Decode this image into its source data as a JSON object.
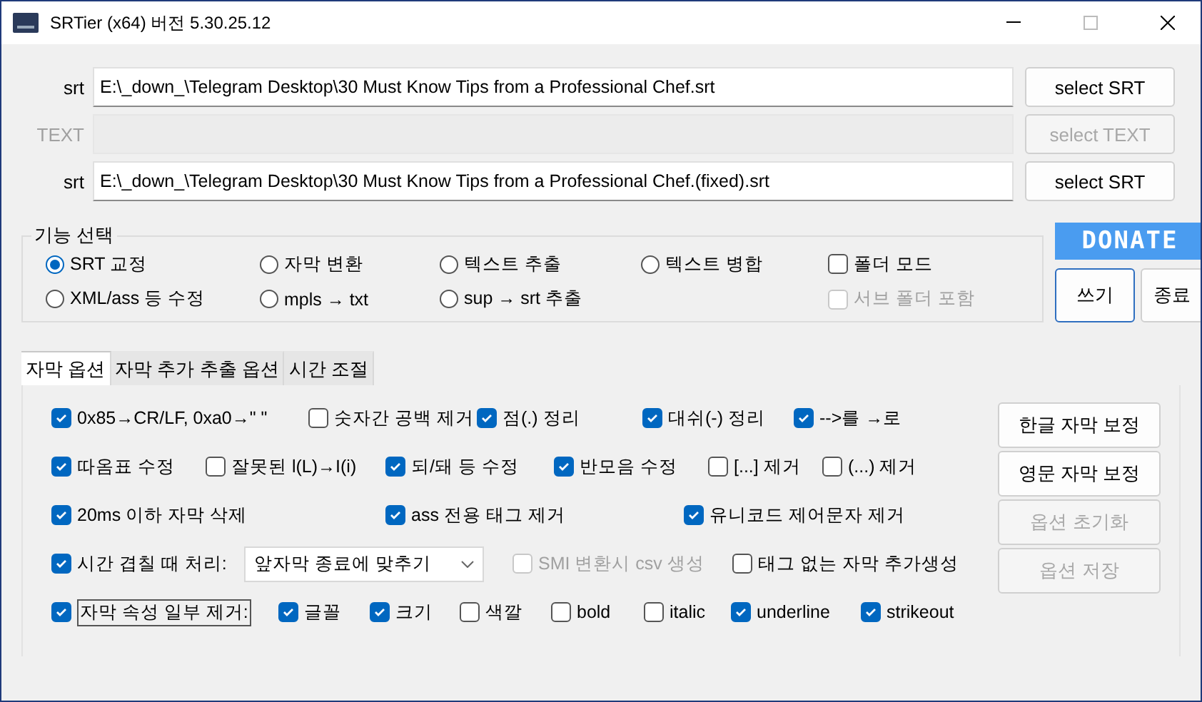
{
  "window": {
    "title": "SRTier (x64) 버전 5.30.25.12"
  },
  "files": [
    {
      "label": "srt",
      "value": "E:\\_down_\\Telegram Desktop\\30 Must Know Tips from a Professional Chef.srt",
      "button": "select SRT",
      "disabled": false
    },
    {
      "label": "TEXT",
      "button": "select TEXT",
      "disabled": true
    },
    {
      "label": "srt",
      "value": "E:\\_down_\\Telegram Desktop\\30 Must Know Tips from a Professional Chef.(fixed).srt",
      "button": "select SRT",
      "disabled": false
    }
  ],
  "function_group": {
    "title": "기능 선택",
    "items": [
      {
        "kind": "radio",
        "label": "SRT 교정",
        "selected": true,
        "disabled": false
      },
      {
        "kind": "radio",
        "label": "자막 변환",
        "selected": false,
        "disabled": false
      },
      {
        "kind": "radio",
        "label": "텍스트 추출",
        "selected": false,
        "disabled": false
      },
      {
        "kind": "radio",
        "label": "텍스트 병합",
        "selected": false,
        "disabled": false
      },
      {
        "kind": "checkbox",
        "label": "폴더 모드",
        "checked": false,
        "disabled": false
      },
      {
        "kind": "radio",
        "label": "XML/ass 등 수정",
        "selected": false,
        "disabled": false
      },
      {
        "kind": "radio",
        "label": "mpls → txt",
        "selected": false,
        "disabled": false
      },
      {
        "kind": "radio",
        "label": "sup → srt 추출",
        "selected": false,
        "disabled": false
      },
      {
        "kind": "empty"
      },
      {
        "kind": "checkbox",
        "label": "서브 폴더 포함",
        "checked": false,
        "disabled": true
      }
    ]
  },
  "donate": "DONATE",
  "write_button": "쓰기",
  "exit_button": "종료",
  "tabs": [
    {
      "label": "자막 옵션",
      "selected": true
    },
    {
      "label": "자막 추가 추출 옵션",
      "selected": false
    },
    {
      "label": "시간 조절",
      "selected": false
    }
  ],
  "option_rows": [
    [
      {
        "kind": "checkbox",
        "label": "0x85→CR/LF, 0xa0→\" \"",
        "checked": true,
        "disabled": false
      },
      {
        "kind": "checkbox",
        "label": "숫자간 공백 제거",
        "checked": false,
        "disabled": false
      },
      {
        "kind": "checkbox",
        "label": "점(.) 정리",
        "checked": true,
        "disabled": false
      },
      {
        "kind": "checkbox",
        "label": "대쉬(-) 정리",
        "checked": true,
        "disabled": false
      },
      {
        "kind": "checkbox",
        "label": "-->를 →로",
        "checked": true,
        "disabled": false
      }
    ],
    [
      {
        "kind": "checkbox",
        "label": "따옴표 수정",
        "checked": true,
        "disabled": false
      },
      {
        "kind": "checkbox",
        "label": "잘못된 l(L)→I(i)",
        "checked": false,
        "disabled": false
      },
      {
        "kind": "checkbox",
        "label": "되/돼 등 수정",
        "checked": true,
        "disabled": false
      },
      {
        "kind": "checkbox",
        "label": "반모음 수정",
        "checked": true,
        "disabled": false
      },
      {
        "kind": "checkbox",
        "label": "[...] 제거",
        "checked": false,
        "disabled": false
      },
      {
        "kind": "checkbox",
        "label": "(...) 제거",
        "checked": false,
        "disabled": false
      }
    ],
    [
      {
        "kind": "checkbox",
        "label": "20ms 이하 자막 삭제",
        "checked": true,
        "disabled": false
      },
      {
        "kind": "checkbox",
        "label": "ass 전용 태그 제거",
        "checked": true,
        "disabled": false
      },
      {
        "kind": "checkbox",
        "label": "유니코드 제어문자 제거",
        "checked": true,
        "disabled": false
      }
    ],
    [
      {
        "kind": "checkbox",
        "label": "시간 겹칠 때 처리:",
        "checked": true,
        "disabled": false
      },
      {
        "kind": "select",
        "value": "앞자막 종료에 맞추기"
      },
      {
        "kind": "checkbox",
        "label": "SMI 변환시 csv 생성",
        "checked": false,
        "disabled": true
      },
      {
        "kind": "checkbox",
        "label": "태그 없는 자막 추가생성",
        "checked": false,
        "disabled": false
      }
    ],
    [
      {
        "kind": "checkbox",
        "label": "자막 속성 일부 제거:",
        "checked": true,
        "disabled": false,
        "focused": true
      },
      {
        "kind": "checkbox",
        "label": "글꼴",
        "checked": true,
        "disabled": false
      },
      {
        "kind": "checkbox",
        "label": "크기",
        "checked": true,
        "disabled": false
      },
      {
        "kind": "checkbox",
        "label": "색깔",
        "checked": false,
        "disabled": false
      },
      {
        "kind": "checkbox",
        "label": "bold",
        "checked": false,
        "disabled": false
      },
      {
        "kind": "checkbox",
        "label": "italic",
        "checked": false,
        "disabled": false
      },
      {
        "kind": "checkbox",
        "label": "underline",
        "checked": true,
        "disabled": false
      },
      {
        "kind": "checkbox",
        "label": "strikeout",
        "checked": true,
        "disabled": false
      }
    ]
  ],
  "side_buttons": [
    {
      "label": "한글 자막 보정",
      "disabled": false
    },
    {
      "label": "영문 자막 보정",
      "disabled": false
    },
    {
      "label": "옵션 초기화",
      "disabled": true
    },
    {
      "label": "옵션 저장",
      "disabled": true
    }
  ]
}
